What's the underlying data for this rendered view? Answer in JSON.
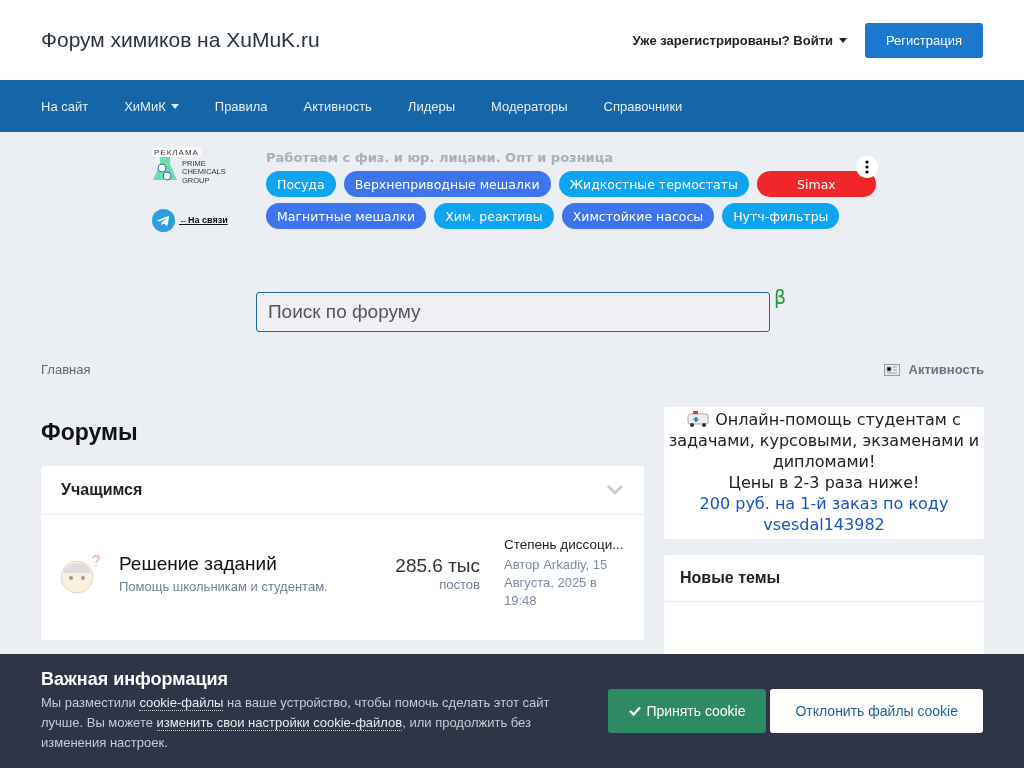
{
  "header": {
    "site_title": "Форум химиков на XuMuK.ru",
    "login": "Уже зарегистрированы? Войти",
    "register": "Регистрация"
  },
  "nav": [
    {
      "label": "На сайт",
      "dropdown": false
    },
    {
      "label": "ХиМиК",
      "dropdown": true
    },
    {
      "label": "Правила",
      "dropdown": false
    },
    {
      "label": "Активность",
      "dropdown": false
    },
    {
      "label": "Лидеры",
      "dropdown": false
    },
    {
      "label": "Модераторы",
      "dropdown": false
    },
    {
      "label": "Справочники",
      "dropdown": false
    }
  ],
  "ad": {
    "badge": "РЕКЛАМА",
    "logo_text": "PRIME CHEMICALS GROUP",
    "contact": "←На связи",
    "tagline": "Работаем с физ. и юр. лицами. Опт и розница",
    "chips": [
      [
        {
          "label": "Посуда",
          "color": "#0ea5f0"
        },
        {
          "label": "Верхнеприводные мешалки",
          "color": "#3d75ec"
        },
        {
          "label": "Жидкостные термостаты",
          "color": "#0ea5f0"
        },
        {
          "label": "Simax",
          "color": "#f0262b"
        }
      ],
      [
        {
          "label": "Магнитные мешалки",
          "color": "#3d75ec"
        },
        {
          "label": "Хим. реактивы",
          "color": "#0ea5f0"
        },
        {
          "label": "Химстойкие насосы",
          "color": "#3d75ec"
        },
        {
          "label": "Нутч-фильтры",
          "color": "#0ea5f0"
        }
      ]
    ]
  },
  "search": {
    "placeholder": "Поиск по форуму",
    "beta": "β"
  },
  "breadcrumb": {
    "home": "Главная",
    "activity": "Активность"
  },
  "page_title": "Форумы",
  "category": {
    "title": "Учащимся",
    "expanded": true,
    "forums": [
      {
        "name": "Решение заданий",
        "description": "Помощь школьникам и студентам.",
        "count": "285.6 тыс",
        "count_label": "постов",
        "last_title": "Степень диссоци...",
        "last_meta": "Автор Arkadiy, 15 Августа, 2025 в 19:48"
      }
    ]
  },
  "promo": {
    "lines": [
      "Онлайн-помощь студентам с задачами, курсовыми, экзаменами и дипломами!",
      "Цены в 2-3 раза ниже!"
    ],
    "link": "200 руб. на 1-й заказ по коду vsesdal143982"
  },
  "new_topics": {
    "title": "Новые темы"
  },
  "cookie": {
    "title": "Важная информация",
    "text_parts": [
      "Мы разместили ",
      "cookie-файлы",
      " на ваше устройство, чтобы помочь сделать этот сайт лучше. Вы можете ",
      "изменить свои настройки cookie-файлов",
      ", или продолжить без изменения настроек."
    ],
    "accept": "Принять cookie",
    "reject": "Отклонить файлы cookie"
  }
}
